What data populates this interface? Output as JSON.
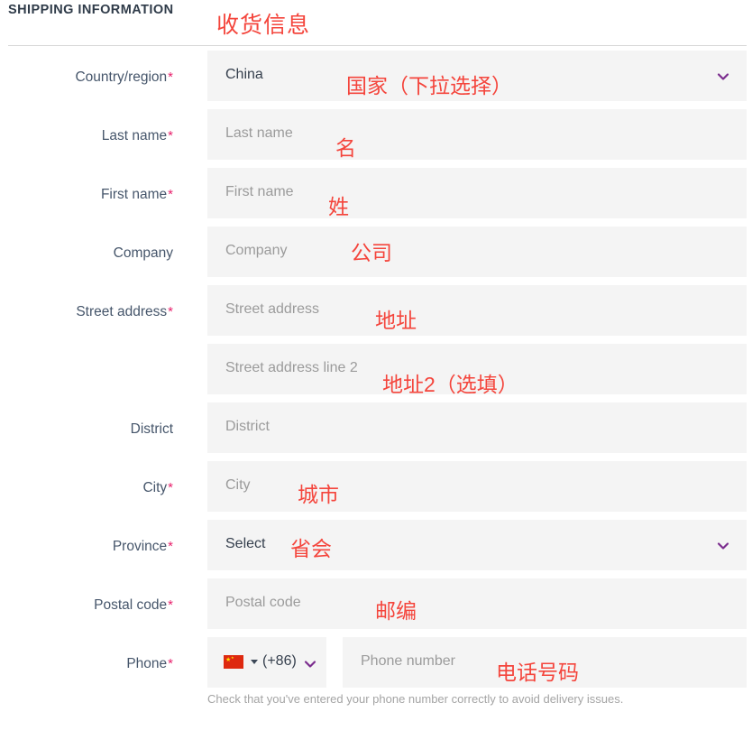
{
  "header": {
    "title": "SHIPPING INFORMATION",
    "annotation": "收货信息"
  },
  "colors": {
    "accent_red": "#f4453c",
    "required_asterisk": "#e8216c",
    "chevron_purple": "#7b2d8e",
    "field_background": "#f4f4f4",
    "label_text": "#46566b",
    "placeholder_text": "#9b9b9b",
    "title_text": "#2f3b49"
  },
  "form": {
    "fields": [
      {
        "label": "Country/region",
        "required": true,
        "type": "select",
        "value": "China",
        "placeholder": "",
        "annotation": "国家（下拉选择）",
        "chevron": "chevron-down-icon"
      },
      {
        "label": "Last name",
        "required": true,
        "type": "text",
        "value": "",
        "placeholder": "Last name",
        "annotation": "名"
      },
      {
        "label": "First name",
        "required": true,
        "type": "text",
        "value": "",
        "placeholder": "First name",
        "annotation": "姓"
      },
      {
        "label": "Company",
        "required": false,
        "type": "text",
        "value": "",
        "placeholder": "Company",
        "annotation": "公司"
      },
      {
        "label": "Street address",
        "required": true,
        "type": "text",
        "value": "",
        "placeholder": "Street address",
        "annotation": "地址"
      },
      {
        "label": "",
        "required": false,
        "type": "text",
        "value": "",
        "placeholder": "Street address line 2",
        "annotation": "地址2（选填）"
      },
      {
        "label": "District",
        "required": false,
        "type": "text",
        "value": "",
        "placeholder": "District",
        "annotation": ""
      },
      {
        "label": "City",
        "required": true,
        "type": "text",
        "value": "",
        "placeholder": "City",
        "annotation": "城市"
      },
      {
        "label": "Province",
        "required": true,
        "type": "select",
        "value": "Select",
        "placeholder": "",
        "annotation": "省会",
        "chevron": "chevron-down-icon"
      },
      {
        "label": "Postal code",
        "required": true,
        "type": "text",
        "value": "",
        "placeholder": "Postal code",
        "annotation": "邮编"
      }
    ],
    "phone": {
      "label": "Phone",
      "required": true,
      "country_flag": "china-flag-icon",
      "dial_code": "(+86)",
      "chevron": "chevron-down-icon",
      "number_placeholder": "Phone number",
      "annotation": "电话号码",
      "helper_text": "Check that you've entered your phone number correctly to avoid delivery issues."
    }
  }
}
